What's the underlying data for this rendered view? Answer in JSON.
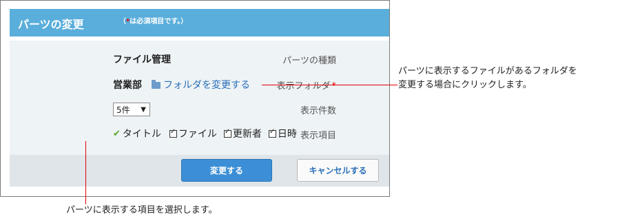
{
  "panel": {
    "title": "パーツの変更",
    "required_note_open": "（",
    "required_note_star": "*",
    "required_note_text": "は必須項目です。）"
  },
  "form": {
    "part_type_label": "パーツの種類",
    "part_type_value": "ファイル管理",
    "folder_label": "表示フォルダ",
    "folder_required": "*",
    "folder_value": "営業部",
    "change_folder_link": "フォルダを変更する",
    "count_label": "表示件数",
    "count_value": "5件",
    "items_label": "表示項目",
    "items": {
      "title": "タイトル",
      "file": "ファイル",
      "updater": "更新者",
      "datetime": "日時"
    }
  },
  "buttons": {
    "submit": "変更する",
    "cancel": "キャンセルする"
  },
  "annotations": {
    "folder_note_line1": "パーツに表示するファイルがあるフォルダを",
    "folder_note_line2": "変更する場合にクリックします。",
    "items_note": "パーツに表示する項目を選択します。"
  },
  "colors": {
    "header": "#5aaedb",
    "primary_button": "#3c8fd6",
    "callout_line": "#e00000"
  }
}
